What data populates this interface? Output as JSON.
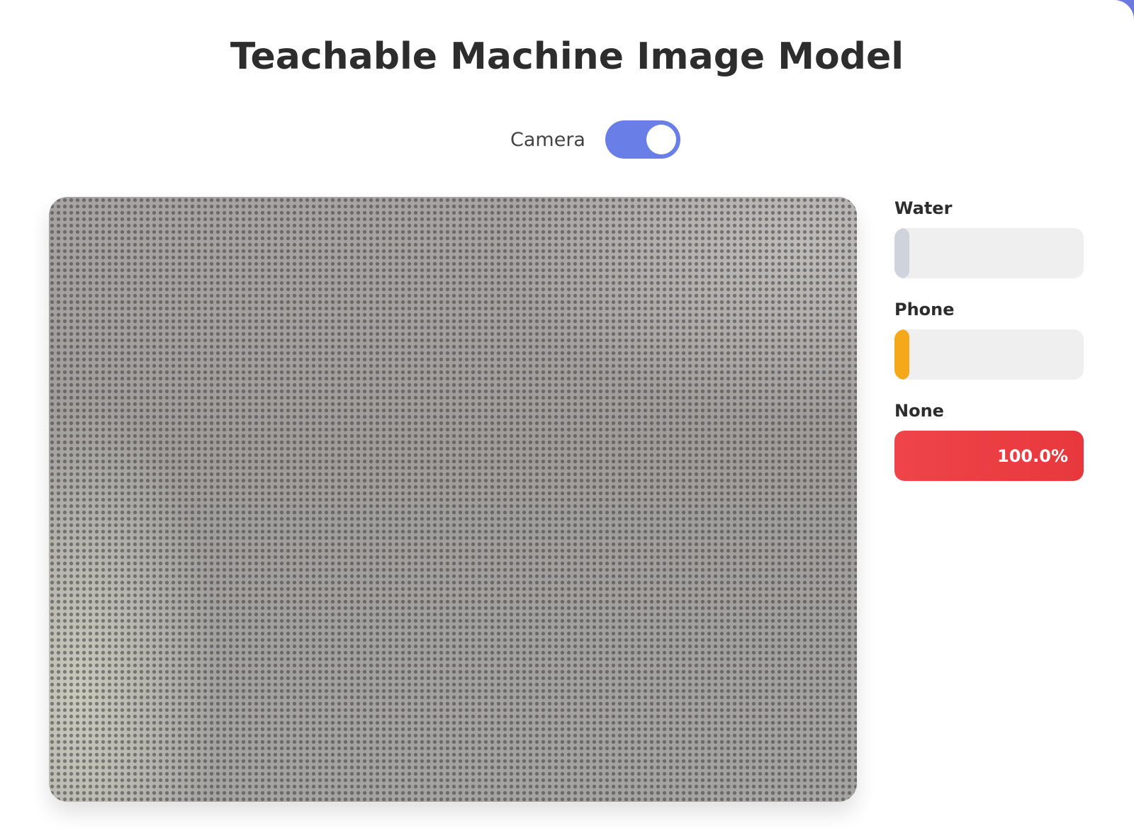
{
  "page": {
    "title": "Teachable Machine Image Model"
  },
  "camera": {
    "label": "Camera",
    "enabled": true
  },
  "predictions": [
    {
      "label": "Water",
      "value": 0.0,
      "value_text": "",
      "color": "#cfd3db"
    },
    {
      "label": "Phone",
      "value": 0.0,
      "value_text": "",
      "color": "#f6a81b"
    },
    {
      "label": "None",
      "value": 1.0,
      "value_text": "100.0%",
      "color": "#e8383d"
    }
  ],
  "colors": {
    "accent": "#6a7ee8",
    "background": "#6b78e0"
  }
}
